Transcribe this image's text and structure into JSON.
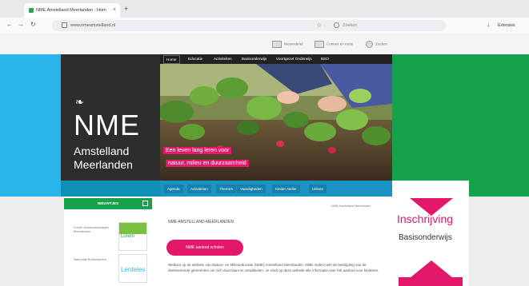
{
  "browser": {
    "tab_title": "NME Amstelland Meerlanden - Hom",
    "new_tab": "+",
    "url": "www.nmeamstelland.nl",
    "search_placeholder": "Zoeken",
    "extensions_label": "Extensies"
  },
  "utility": {
    "items": [
      "Nieuwsbrief",
      "Contact en route",
      "Zoeken"
    ]
  },
  "logo": {
    "icon": "bee-logo-icon",
    "name": "NME",
    "line1": "Amstelland",
    "line2": "Meerlanden"
  },
  "nav": {
    "items": [
      "Home",
      "Educatie",
      "Activiteiten",
      "Basisonderwijs",
      "Voortgezet Onderwijs",
      "BSO"
    ]
  },
  "hero": {
    "banner_line1": "Een leven lang leren voor",
    "banner_line2": "natuur, milieu en duurzaamheid"
  },
  "subnav": {
    "items": [
      "Agenda",
      "Activiteiten",
      "Thema's",
      "Vaardigheden",
      "Kinder Atelier",
      "Uitleen"
    ]
  },
  "sidebar": {
    "heading": "NIEUWTJES",
    "item1": "Lorem Natuurwerkdagen Meerlanden ...",
    "item2": "Natuurlijk Buitenspelen ...",
    "thumb1": "Lorem",
    "thumb2": "Lenteles"
  },
  "main": {
    "breadcrumb": "NME Amstelland Meerlanden",
    "title": "NME AMSTELLAND-MEERLANDEN",
    "cta": "NME aanbod scholen",
    "intro": "Welkom op de website van Natuur- en Milieueducatie (NME) Amstelland Meerlanden. NME onderzoekt de bestrijding van de deelnemende gemeenten om zich duurzaam te ontwikkelen. Je vindt op deze website alle informatie over het aanbod voor kinderen."
  },
  "promo": {
    "title": "Inschrijving",
    "subtitle": "Basisonderwijs"
  },
  "colors": {
    "pink": "#e3186b",
    "green": "#16a24a",
    "blue": "#29b5ea",
    "dark": "#2d2d2d"
  }
}
